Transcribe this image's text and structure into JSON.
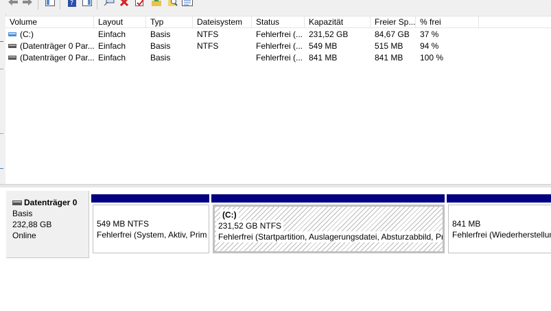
{
  "toolbar": {
    "buttons": [
      {
        "icon": "back-arrow-icon"
      },
      {
        "icon": "forward-arrow-icon"
      },
      {
        "icon": "show-pane-icon"
      },
      {
        "icon": "help-icon"
      },
      {
        "icon": "properties-icon"
      },
      {
        "icon": "connect-icon"
      },
      {
        "icon": "delete-icon"
      },
      {
        "icon": "check-icon"
      },
      {
        "icon": "import-icon"
      },
      {
        "icon": "search-icon"
      },
      {
        "icon": "settings-list-icon"
      }
    ]
  },
  "volume_list": {
    "columns": [
      "Volume",
      "Layout",
      "Typ",
      "Dateisystem",
      "Status",
      "Kapazität",
      "Freier Sp...",
      "% frei"
    ],
    "rows": [
      {
        "icon": "volume-c-icon",
        "cells": [
          "(C:)",
          "Einfach",
          "Basis",
          "NTFS",
          "Fehlerfrei (...",
          "231,52 GB",
          "84,67 GB",
          "37 %"
        ]
      },
      {
        "icon": "partition-icon",
        "cells": [
          "(Datenträger 0 Par...",
          "Einfach",
          "Basis",
          "NTFS",
          "Fehlerfrei (...",
          "549 MB",
          "515 MB",
          "94 %"
        ]
      },
      {
        "icon": "partition-icon",
        "cells": [
          "(Datenträger 0 Par...",
          "Einfach",
          "Basis",
          "",
          "Fehlerfrei (...",
          "841 MB",
          "841 MB",
          "100 %"
        ]
      }
    ]
  },
  "disk": {
    "name": "Datenträger 0",
    "type": "Basis",
    "size": "232,88 GB",
    "status": "Online",
    "partitions": [
      {
        "title": "",
        "size": "549 MB NTFS",
        "status": "Fehlerfrei (System, Aktiv, Prim"
      },
      {
        "title": "(C:)",
        "size": "231,52 GB NTFS",
        "status": "Fehlerfrei (Startpartition, Auslagerungsdatei, Absturzabbild, Pri"
      },
      {
        "title": "",
        "size": "841 MB",
        "status": "Fehlerfrei (Wiederherstellun"
      }
    ]
  },
  "colors": {
    "partition_bar": "#000080",
    "selection_hatch": "#b8b8b8"
  }
}
